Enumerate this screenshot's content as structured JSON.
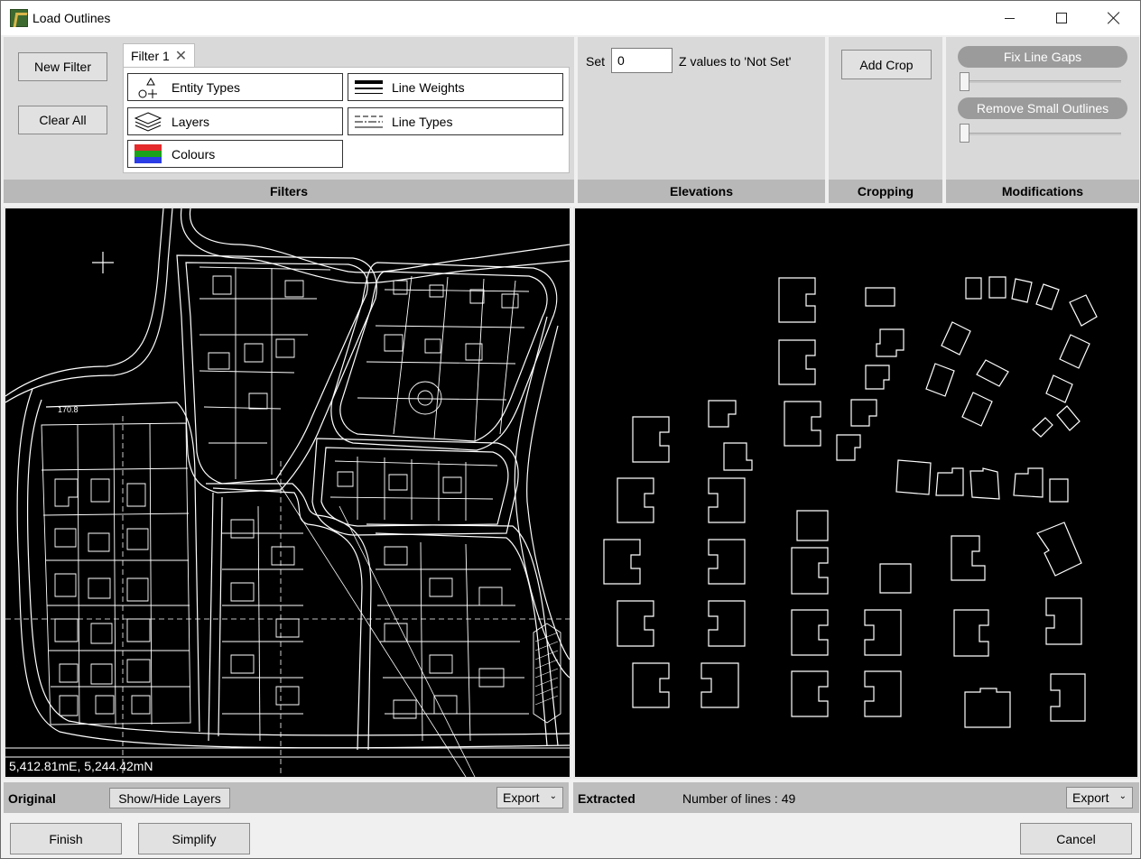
{
  "window": {
    "title": "Load Outlines",
    "app_icon": "app-logo-icon"
  },
  "filters": {
    "new_filter_label": "New Filter",
    "clear_all_label": "Clear All",
    "tab_label": "Filter 1",
    "tab_close_glyph": "✕",
    "buttons": {
      "entity_types": "Entity Types",
      "line_weights": "Line Weights",
      "layers": "Layers",
      "line_types": "Line Types",
      "colours": "Colours"
    },
    "footer": "Filters"
  },
  "elevations": {
    "set_label": "Set",
    "value": "0",
    "suffix": "Z values to 'Not Set'",
    "footer": "Elevations"
  },
  "cropping": {
    "add_crop_label": "Add Crop",
    "footer": "Cropping"
  },
  "modifications": {
    "fix_line_gaps_label": "Fix Line Gaps",
    "remove_small_outlines_label": "Remove Small Outlines",
    "fix_line_gaps_level": 0,
    "remove_small_outlines_level": 0,
    "footer": "Modifications"
  },
  "original": {
    "coordinates": "5,412.81mE, 5,244.42mN",
    "label": "Original",
    "show_hide_label": "Show/Hide Layers",
    "export_label": "Export"
  },
  "extracted": {
    "label": "Extracted",
    "line_count_text": "Number of lines : 49",
    "export_label": "Export"
  },
  "actions": {
    "finish_label": "Finish",
    "simplify_label": "Simplify",
    "cancel_label": "Cancel"
  },
  "colors": {
    "panel_bg": "#d9d9d9",
    "panel_footer": "#b8b8b8",
    "canvas_bg": "#000000",
    "pill_bg": "#9b9b9b",
    "colour_swatch": [
      "#e52b2b",
      "#1aa31a",
      "#2b3de5"
    ]
  }
}
